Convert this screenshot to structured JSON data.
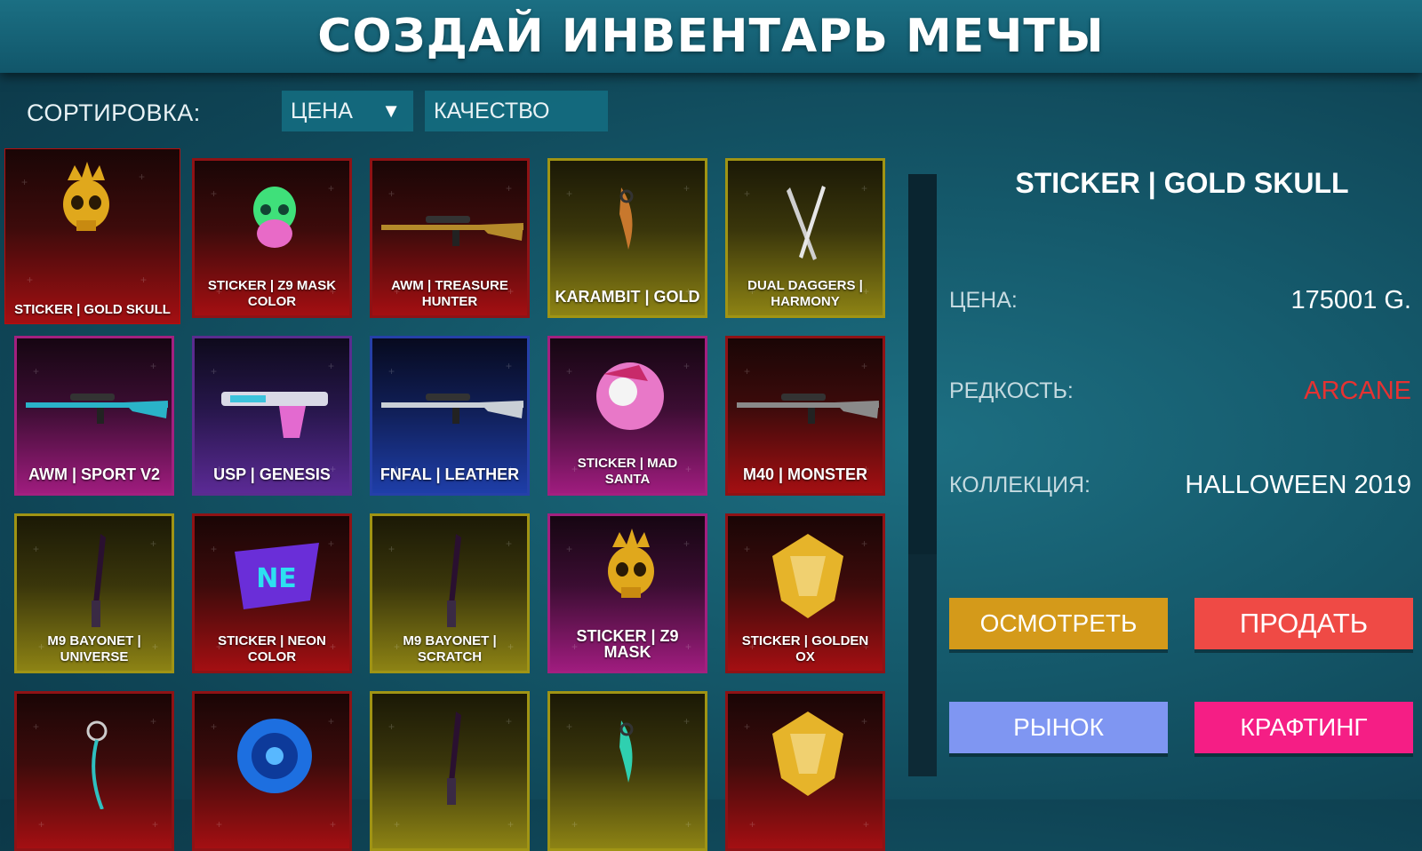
{
  "header": {
    "title": "СОЗДАЙ ИНВЕНТАРЬ МЕЧТЫ"
  },
  "sort": {
    "label": "СОРТИРОВКА:",
    "price_label": "ЦЕНА",
    "price_arrow": "▼",
    "quality_label": "КАЧЕСТВО"
  },
  "colors": {
    "red": "#a40f12",
    "gold": "#8d8314",
    "pink": "#9f1c7e",
    "purple": "#5b2a95",
    "blue": "#1e3ea8",
    "inspect": "#d49a1a",
    "sell": "#ef4a45",
    "market": "#7f96f2",
    "craft": "#f51e85",
    "arcane": "#e63232"
  },
  "inventory": [
    {
      "name": "STICKER | GOLD SKULL",
      "rarity": "red",
      "icon": "gold-skull-sticker-icon",
      "selected": true
    },
    {
      "name": "STICKER | Z9 MASK COLOR",
      "rarity": "red",
      "icon": "z9-mask-color-sticker-icon"
    },
    {
      "name": "AWM | TREASURE HUNTER",
      "rarity": "red",
      "icon": "sniper-rifle-gold-icon"
    },
    {
      "name": "KARAMBIT | GOLD",
      "rarity": "gold",
      "icon": "karambit-knife-icon"
    },
    {
      "name": "DUAL DAGGERS | HARMONY",
      "rarity": "gold",
      "icon": "dual-daggers-icon"
    },
    {
      "name": "AWM | SPORT V2",
      "rarity": "pink",
      "icon": "sniper-rifle-sport-icon"
    },
    {
      "name": "USP | GENESIS",
      "rarity": "purple",
      "icon": "pistol-genesis-icon"
    },
    {
      "name": "FNFAL | LEATHER",
      "rarity": "blue",
      "icon": "rifle-leather-icon"
    },
    {
      "name": "STICKER | MAD SANTA",
      "rarity": "pink",
      "icon": "mad-santa-sticker-icon"
    },
    {
      "name": "M40 | MONSTER",
      "rarity": "red",
      "icon": "sniper-rifle-monster-icon"
    },
    {
      "name": "M9 BAYONET | UNIVERSE",
      "rarity": "gold",
      "icon": "bayonet-universe-icon"
    },
    {
      "name": "STICKER | NEON COLOR",
      "rarity": "red",
      "icon": "neon-sticker-icon"
    },
    {
      "name": "M9 BAYONET | SCRATCH",
      "rarity": "gold",
      "icon": "bayonet-scratch-icon"
    },
    {
      "name": "STICKER | Z9 MASK",
      "rarity": "pink",
      "icon": "z9-mask-gold-sticker-icon"
    },
    {
      "name": "STICKER | GOLDEN OX",
      "rarity": "red",
      "icon": "golden-ox-sticker-icon"
    },
    {
      "name": "",
      "rarity": "red",
      "icon": "charm-pendant-icon"
    },
    {
      "name": "",
      "rarity": "red",
      "icon": "blue-vortex-sticker-icon"
    },
    {
      "name": "",
      "rarity": "gold",
      "icon": "dark-knife-icon"
    },
    {
      "name": "",
      "rarity": "gold",
      "icon": "green-karambit-icon"
    },
    {
      "name": "",
      "rarity": "red",
      "icon": "dragon-sticker-icon"
    }
  ],
  "detail": {
    "title": "STICKER | GOLD SKULL",
    "price_label": "ЦЕНА:",
    "price_value": "175001 G.",
    "rarity_label": "РЕДКОСТЬ:",
    "rarity_value": "ARCANE",
    "collection_label": "КОЛЛЕКЦИЯ:",
    "collection_value": "HALLOWEEN 2019"
  },
  "actions": {
    "inspect": "ОСМОТРЕТЬ",
    "sell": "ПРОДАТЬ",
    "market": "РЫНОК",
    "craft": "КРАФТИНГ"
  }
}
